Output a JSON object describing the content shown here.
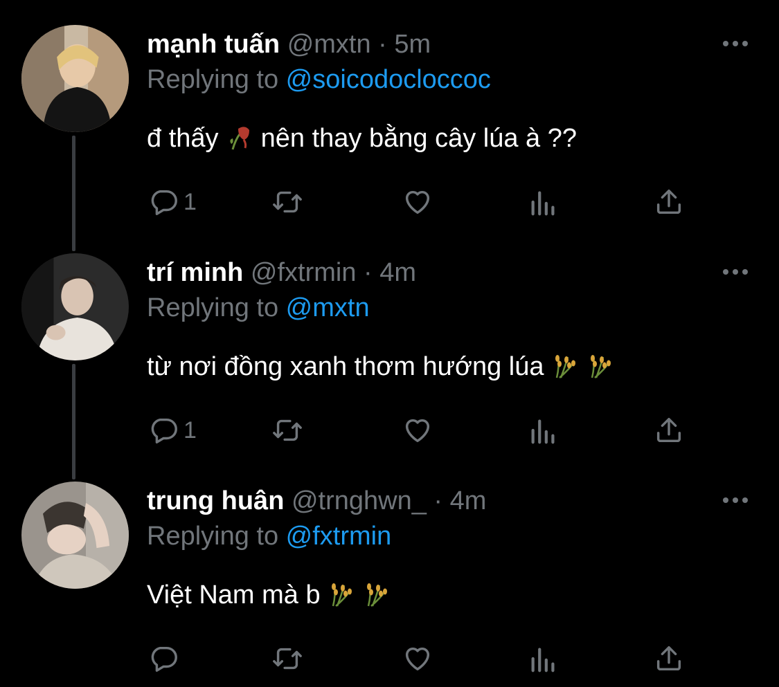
{
  "tweets": [
    {
      "name": "mạnh tuấn",
      "handle": "@mxtn",
      "time": "5m",
      "replying_label": "Replying to ",
      "replying_to": "@soicodocloccoc",
      "text_before": "đ thấy ",
      "text_after": "  nên thay bằng cây lúa à ??",
      "emoji": [
        "wilted-flower-icon"
      ],
      "reply_count": "1"
    },
    {
      "name": "trí minh",
      "handle": "@fxtrmin",
      "time": "4m",
      "replying_label": "Replying to ",
      "replying_to": "@mxtn",
      "text_before": "từ nơi đồng xanh thơm hướng lúa ",
      "text_after": "",
      "emoji": [
        "rice-sheaf-icon",
        "rice-sheaf-icon"
      ],
      "reply_count": "1"
    },
    {
      "name": "trung huân",
      "handle": "@trnghwn_",
      "time": "4m",
      "replying_label": "Replying to ",
      "replying_to": "@fxtrmin",
      "text_before": "Việt Nam mà b ",
      "text_after": "",
      "emoji": [
        "rice-sheaf-icon",
        "rice-sheaf-icon"
      ],
      "reply_count": ""
    }
  ],
  "separator": " · ",
  "colors": {
    "background": "#000000",
    "muted": "#71767b",
    "link": "#1d9bf0",
    "text": "#ffffff"
  }
}
